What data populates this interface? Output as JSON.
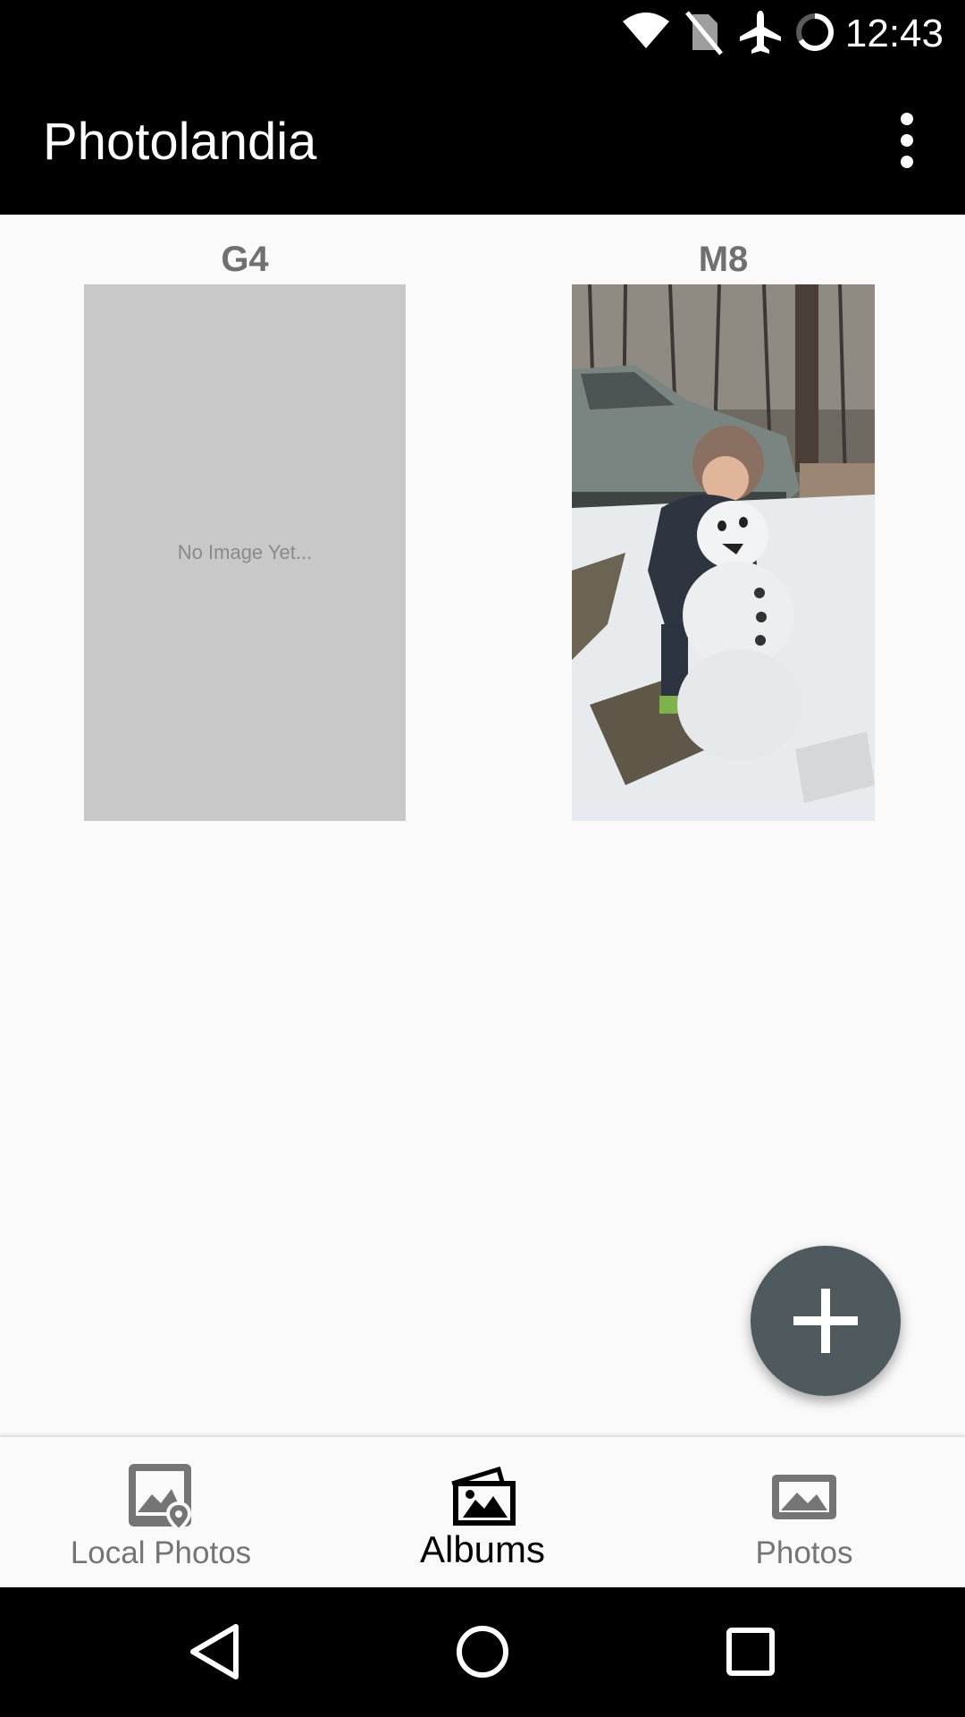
{
  "status_bar": {
    "time": "12:43",
    "icons": [
      "wifi-icon",
      "no-sim-icon",
      "airplane-mode-icon",
      "loading-spinner-icon"
    ]
  },
  "app_bar": {
    "title": "Photolandia",
    "menu_icon": "more-vert-icon"
  },
  "albums": [
    {
      "name": "G4",
      "has_image": false,
      "placeholder_text": "No Image Yet..."
    },
    {
      "name": "M8",
      "has_image": true,
      "image_description": "child-with-snowman-photo"
    }
  ],
  "fab": {
    "icon": "add-icon"
  },
  "bottom_nav": {
    "items": [
      {
        "label": "Local Photos",
        "icon": "local-photos-icon",
        "active": false
      },
      {
        "label": "Albums",
        "icon": "albums-icon",
        "active": true
      },
      {
        "label": "Photos",
        "icon": "photos-icon",
        "active": false
      }
    ]
  },
  "system_nav": {
    "buttons": [
      "back-icon",
      "home-icon",
      "recents-icon"
    ]
  },
  "colors": {
    "app_bar_bg": "#000000",
    "content_bg": "#fafafa",
    "fab_bg": "#4f5a5f",
    "placeholder_bg": "#c8c8c8",
    "nav_active": "#000000",
    "nav_inactive": "#757575"
  }
}
